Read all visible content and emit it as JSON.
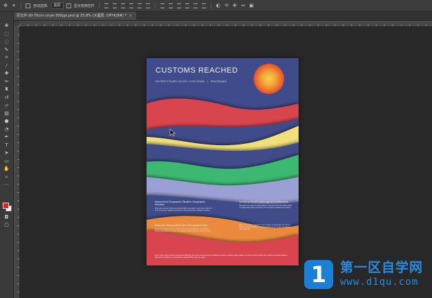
{
  "options_bar": {
    "auto_select_label": "自动选择:",
    "auto_select_value": "图层",
    "show_transform_label": "显示变换控件"
  },
  "document_tab": {
    "title": "原文件-30-70cm-cmyk-300ppi.psd @ 25.8% (大图层, CMYK/8#) *",
    "close_glyph": "×"
  },
  "tools": [
    {
      "icon": "move-icon",
      "glyph": "✥"
    },
    {
      "icon": "marquee-icon",
      "glyph": "⬚"
    },
    {
      "icon": "lasso-icon",
      "glyph": "◌"
    },
    {
      "icon": "quick-select-icon",
      "glyph": "✎"
    },
    {
      "icon": "crop-icon",
      "glyph": "⌗"
    },
    {
      "icon": "eyedropper-icon",
      "glyph": "⁄"
    },
    {
      "icon": "healing-brush-icon",
      "glyph": "✚"
    },
    {
      "icon": "brush-icon",
      "glyph": "✏"
    },
    {
      "icon": "stamp-icon",
      "glyph": "♜"
    },
    {
      "icon": "history-brush-icon",
      "glyph": "↺"
    },
    {
      "icon": "eraser-icon",
      "glyph": "▱"
    },
    {
      "icon": "gradient-icon",
      "glyph": "▤"
    },
    {
      "icon": "blur-icon",
      "glyph": "●"
    },
    {
      "icon": "dodge-icon",
      "glyph": "◔"
    },
    {
      "icon": "pen-icon",
      "glyph": "✒"
    },
    {
      "icon": "type-icon",
      "glyph": "T"
    },
    {
      "icon": "path-select-icon",
      "glyph": "➤"
    },
    {
      "icon": "shape-icon",
      "glyph": "▭"
    },
    {
      "icon": "hand-icon",
      "glyph": "✋"
    },
    {
      "icon": "zoom-icon",
      "glyph": "⌕"
    },
    {
      "icon": "more-tools-icon",
      "glyph": "⋯"
    }
  ],
  "poster": {
    "title": "CUSTOMS REACHED",
    "subtitle_left": "ENTREPOTSURE ON KEY LIVELIHOOD",
    "subtitle_sep": "|",
    "subtitle_right": "PROGRAMM",
    "block1_heading": "Natural And Geographic Situation Geographic Situation",
    "block1_body": "Vitae quis erat nisi ut felis venenatis facilisis consequat. Lorem ipsum dolor sit amet consectetur adipiscing elit sed do eiusmod tempor incididunt ut labore.",
    "block2_heading": "Access to 90,000 years ago and settlements",
    "block2_body": "Duis aute irure dolor in reprehenderit in voluptate velit esse cillum dolore eu fugiat nulla pariatur. Excepteur sint occaecat cupidatat non proident.",
    "block3_heading": "Economic Development And Demographic Data",
    "block3_body": "Sed ut perspiciatis unde omnis iste natus error sit voluptatem accusantium doloremque laudantium totam rem aperiam eaque ipsa quae ab illo inventore.",
    "block4_body": "Nemo enim ipsam voluptatem quia voluptas sit aspernatur aut odit aut fugit sed quia consequuntur magni dolores eos qui ratione voluptatem sequi nesciunt.",
    "footer": "Lorem ipsum dolor sit amet consectetur adipiscing elit sed do eiusmod tempor incididunt ut labore et dolore magna aliqua. Ut enim ad minim veniam quis nostrud exercitation ullamco laboris nisi ut aliquip ex ea commodo consequat duis aute irure dolor."
  },
  "colors": {
    "poster_blue": "#3f4b8a",
    "wave_red": "#d8454f",
    "wave_yellow": "#efe07a",
    "wave_green": "#3eb872",
    "wave_lavender": "#9aa0d4",
    "wave_orange": "#ea8a3c",
    "foreground_swatch": "#e3221f",
    "background_swatch": "#ffffff",
    "watermark_blue": "#1b7fd6"
  },
  "watermark": {
    "icon_glyph": "1",
    "title": "第一区自学网",
    "url": "www.d1qu.com"
  }
}
